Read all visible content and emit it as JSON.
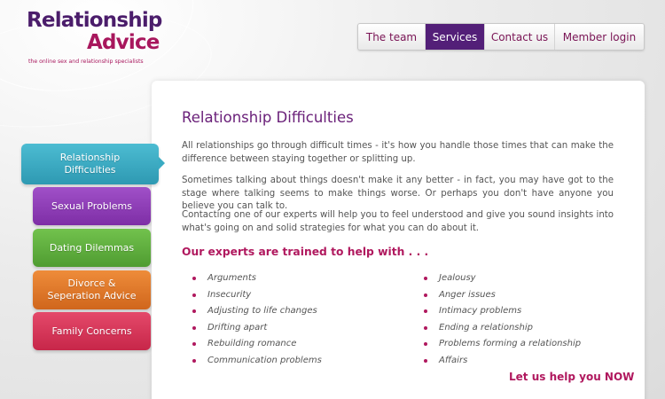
{
  "logo": {
    "line1": "Relationship",
    "line2": "Advice",
    "tagline": "the online sex and relationship specialists"
  },
  "nav": {
    "items": [
      {
        "label": "The team",
        "active": false
      },
      {
        "label": "Services",
        "active": true
      },
      {
        "label": "Contact us",
        "active": false
      },
      {
        "label": "Member login",
        "active": false
      }
    ]
  },
  "sidebar": {
    "items": [
      {
        "label": "Relationship Difficulties",
        "color": "#3aabc3",
        "active": true
      },
      {
        "label": "Sexual Problems",
        "color": "#8f3bb8",
        "active": false
      },
      {
        "label": "Dating Dilemmas",
        "color": "#5fae3e",
        "active": false
      },
      {
        "label": "Divorce & Seperation Advice",
        "color": "#e0792a",
        "active": false
      },
      {
        "label": "Family Concerns",
        "color": "#d9375a",
        "active": false
      }
    ]
  },
  "main": {
    "title": "Relationship Difficulties",
    "paragraphs": [
      "All relationships go through difficult times - it's how you handle those times that can make the difference between staying together or splitting up.",
      "Sometimes talking about things doesn't make it any better - in fact, you may have got to the stage where talking seems to make things worse. Or perhaps you don't have anyone you believe you can talk to.",
      "Contacting one of our experts will help you to feel understood and give you sound insights into what's going on and solid strategies for what you can do about it."
    ],
    "subheading": "Our experts are trained to help with . . .",
    "list_left": [
      "Arguments",
      "Insecurity",
      "Adjusting to life changes",
      "Drifting apart",
      "Rebuilding romance",
      "Communication problems"
    ],
    "list_right": [
      "Jealousy",
      "Anger issues",
      "Intimacy problems",
      "Ending a relationship",
      "Problems forming a relationship",
      "Affairs"
    ],
    "cta": "Let us help you NOW"
  },
  "colors": {
    "brand_purple": "#531f78",
    "brand_magenta": "#b0185e"
  }
}
